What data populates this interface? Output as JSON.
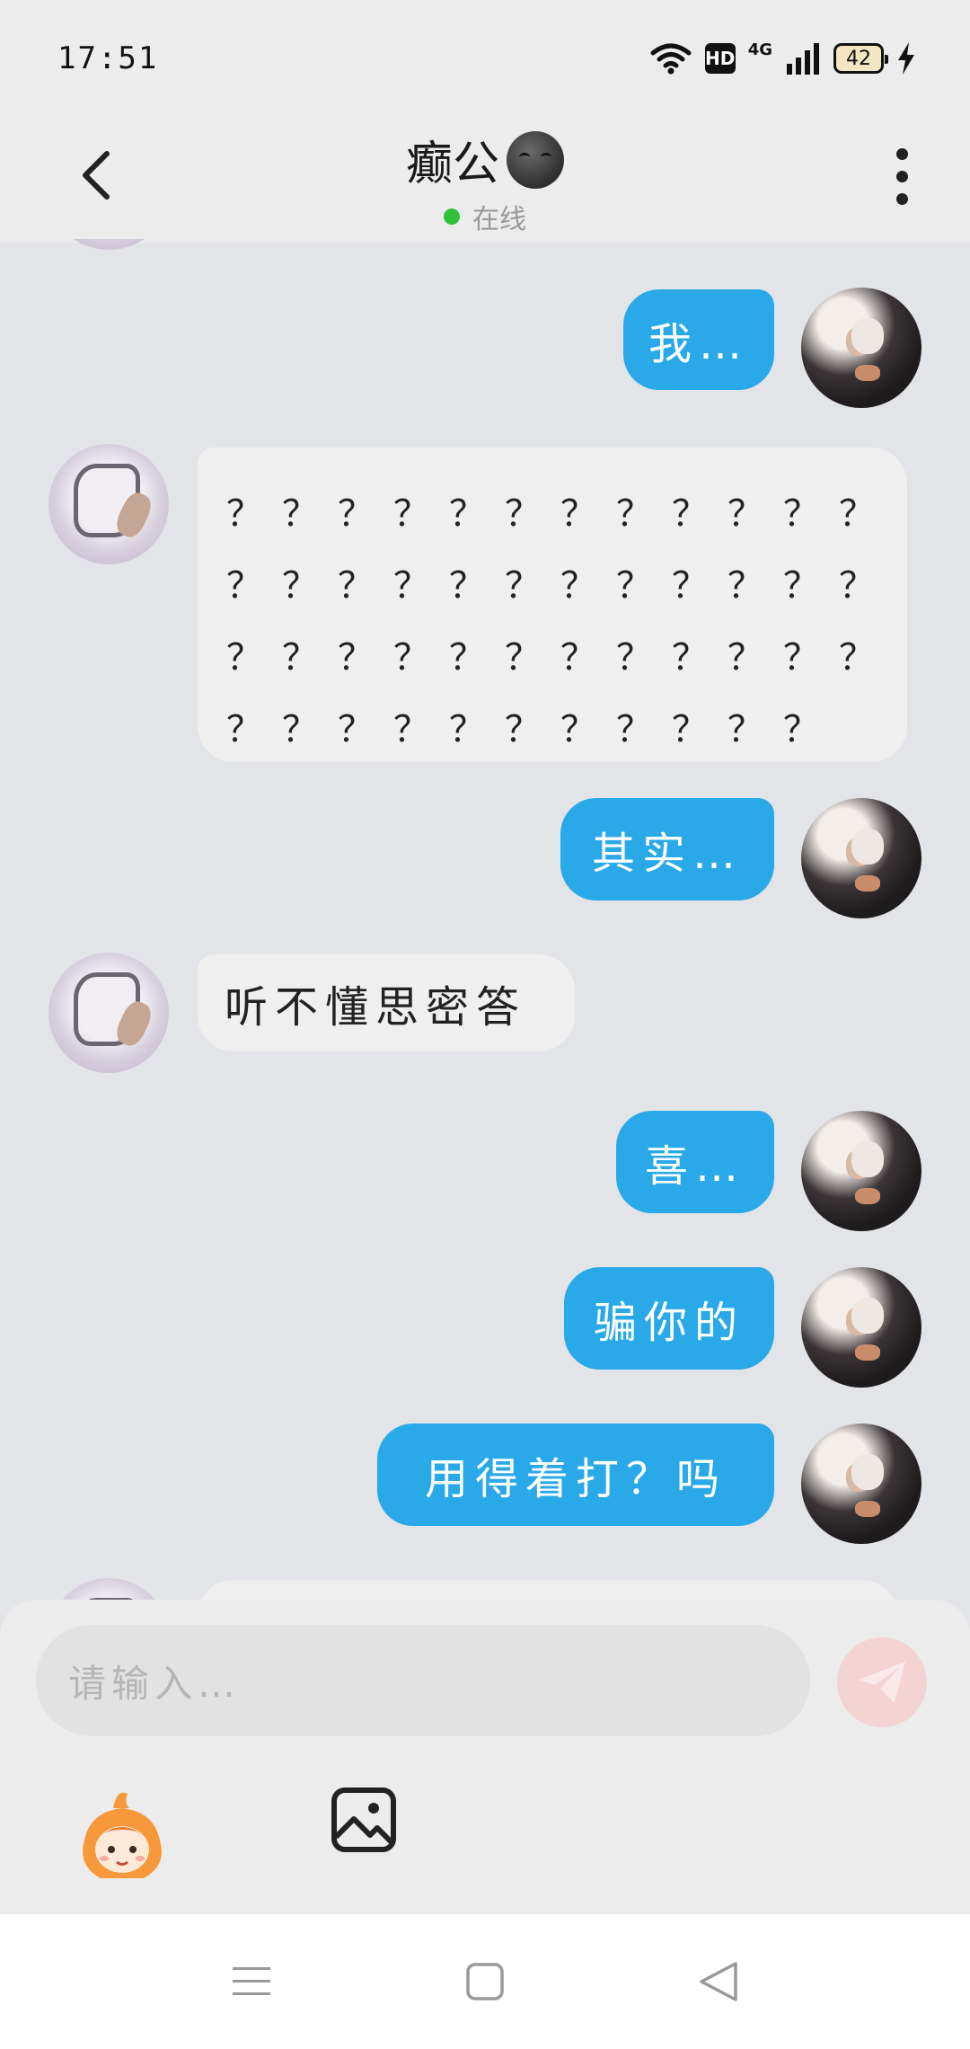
{
  "status_bar": {
    "time": "17:51",
    "network": "4G",
    "hd": "HD",
    "battery": "42"
  },
  "header": {
    "title": "癫公",
    "status": "在线"
  },
  "messages": [
    {
      "sender": "me",
      "text": "我…"
    },
    {
      "sender": "other",
      "rows": [
        [
          "？",
          "？",
          "？",
          "？",
          "？",
          "？",
          "？",
          "？",
          "？",
          "？",
          "？",
          "？"
        ],
        [
          "？",
          "？",
          "？",
          "？",
          "？",
          "？",
          "？",
          "？",
          "？",
          "？",
          "？",
          "？"
        ],
        [
          "？",
          "？",
          "？",
          "？",
          "？",
          "？",
          "？",
          "？",
          "？",
          "？",
          "？",
          "？"
        ],
        [
          "？",
          "？",
          "？",
          "？",
          "？",
          "？",
          "？",
          "？",
          "？",
          "？",
          "？"
        ]
      ]
    },
    {
      "sender": "me",
      "text": "其实…"
    },
    {
      "sender": "other",
      "text": "听不懂思密答"
    },
    {
      "sender": "me",
      "text": "喜…"
    },
    {
      "sender": "me",
      "text": "骗你的"
    },
    {
      "sender": "me",
      "text": "用得着打？吗"
    }
  ],
  "input": {
    "placeholder": "请输入…"
  },
  "colors": {
    "my_bubble": "#29a9e8",
    "other_bubble": "#efefef",
    "online": "#2fc23a",
    "send_button": "#f4d3d3"
  }
}
